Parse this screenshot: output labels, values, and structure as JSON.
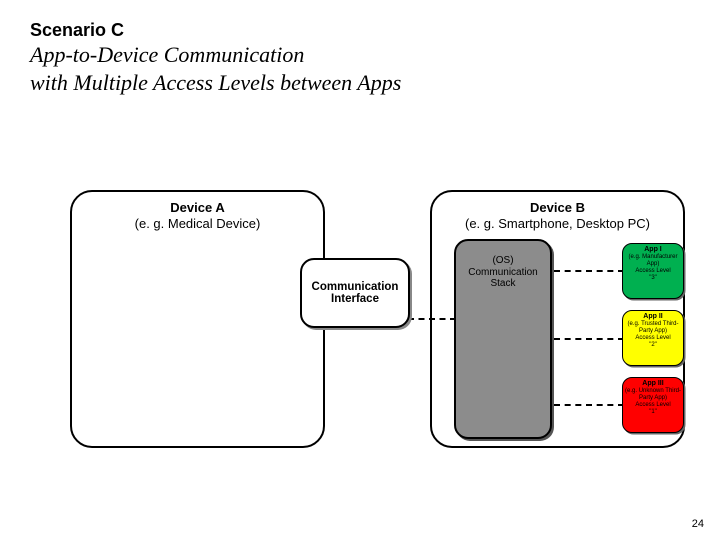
{
  "header": {
    "scenario_label": "Scenario C",
    "title_line1": "App-to-Device Communication",
    "title_line2": "with Multiple Access Levels between Apps"
  },
  "deviceA": {
    "name": "Device A",
    "subtitle": "(e. g. Medical Device)"
  },
  "deviceB": {
    "name": "Device B",
    "subtitle": "(e. g. Smartphone, Desktop PC)"
  },
  "comm_interface": {
    "line1": "Communication",
    "line2": "Interface"
  },
  "os_stack": {
    "line1": "(OS)",
    "line2": "Communication",
    "line3": "Stack"
  },
  "apps": {
    "app1": {
      "name": "App I",
      "desc": "(e.g. Manufacturer App)",
      "level_label": "Access Level",
      "level": "\"3\"",
      "color": "#00b050"
    },
    "app2": {
      "name": "App II",
      "desc": "(e.g. Trusted Third-Party App)",
      "level_label": "Access Level",
      "level": "\"2\"",
      "color": "#ffff00"
    },
    "app3": {
      "name": "App III",
      "desc": "(e.g. Unknown Third-Party App)",
      "level_label": "Access Level",
      "level": "\"1\"",
      "color": "#ff0000"
    }
  },
  "page_number": "24"
}
